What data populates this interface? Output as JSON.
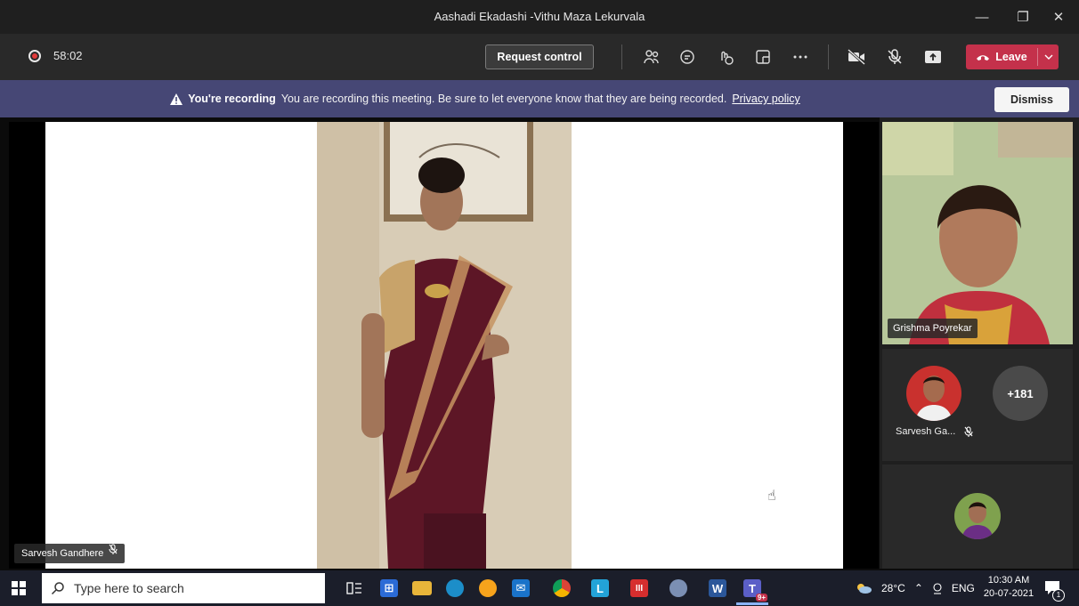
{
  "window": {
    "title": "Aashadi Ekadashi -Vithu Maza Lekurvala",
    "minimize": "—",
    "restore": "❐",
    "close": "✕"
  },
  "toolbar": {
    "timer": "58:02",
    "request_control_label": "Request control",
    "leave_label": "Leave"
  },
  "banner": {
    "heading": "You're recording",
    "message": "You are recording this meeting. Be sure to let everyone know that they are being recorded.",
    "privacy_link": "Privacy policy",
    "dismiss_label": "Dismiss"
  },
  "stage": {
    "speaker_name": "Sarvesh Gandhere"
  },
  "participants": {
    "tile1_name": "Grishma Poyrekar",
    "tile2_name_short": "Sarvesh Ga...",
    "more_count": "+181"
  },
  "taskbar": {
    "search_placeholder": "Type here to search",
    "weather": "28°C",
    "language": "ENG",
    "time": "10:30 AM",
    "date": "20-07-2021",
    "teams_badge": "9+",
    "notification_count": "1"
  },
  "colors": {
    "banner": "#464775",
    "leave": "#c4314b",
    "toolbar": "#292929",
    "taskbar": "#1b1e2a"
  }
}
